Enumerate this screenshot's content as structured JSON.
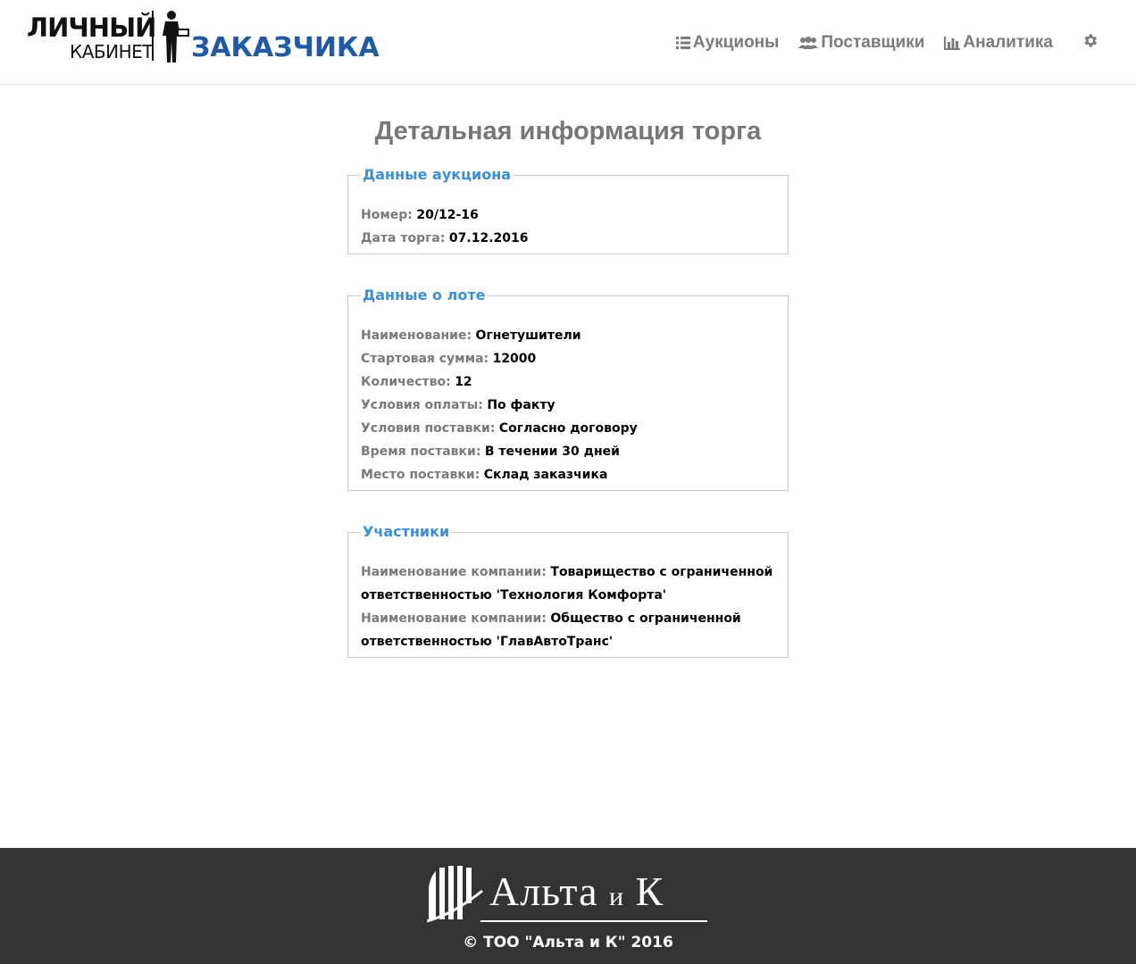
{
  "header": {
    "logo": {
      "line1": "ЛИЧНЫЙ",
      "line2": "КАБИНЕТ",
      "brand": "ЗАКАЗЧИКА"
    },
    "nav": [
      {
        "label": "Аукционы",
        "icon": "list-icon"
      },
      {
        "label": "Поставщики",
        "icon": "users-icon"
      },
      {
        "label": "Аналитика",
        "icon": "bar-chart-icon"
      }
    ],
    "settings_icon": "gear-icon",
    "nav_color": "#7b7b7b",
    "brand_color": "#1e5aa8"
  },
  "main": {
    "title": "Детальная информация торга",
    "auction": {
      "legend": "Данные аукциона",
      "rows": [
        {
          "label": "Номер:",
          "value": "20/12-16"
        },
        {
          "label": "Дата торга:",
          "value": "07.12.2016"
        }
      ]
    },
    "lot": {
      "legend": "Данные о лоте",
      "rows": [
        {
          "label": "Наименование:",
          "value": "Огнетушители"
        },
        {
          "label": "Стартовая сумма:",
          "value": "12000"
        },
        {
          "label": "Количество:",
          "value": "12"
        },
        {
          "label": "Условия оплаты:",
          "value": "По факту"
        },
        {
          "label": "Условия поставки:",
          "value": "Согласно договору"
        },
        {
          "label": "Время поставки:",
          "value": "В течении 30 дней"
        },
        {
          "label": "Место поставки:",
          "value": "Склад заказчика"
        }
      ]
    },
    "participants": {
      "legend": "Участники",
      "rows": [
        {
          "label": "Наименование компании:",
          "value": "Товарищество с ограниченной ответственностью 'Технология Комфорта'"
        },
        {
          "label": "Наименование компании:",
          "value": "Общество с ограниченной ответственностью 'ГлавАвтоТранс'"
        }
      ]
    },
    "legend_color": "#3a8fe0"
  },
  "footer": {
    "logo_main": "Альта",
    "logo_and": "и",
    "logo_k": "К",
    "copyright": "© ТОО \"Альта и К\" 2016",
    "background": "#333333"
  }
}
